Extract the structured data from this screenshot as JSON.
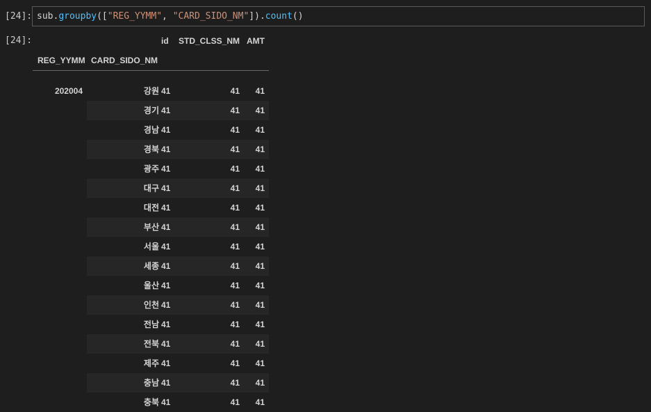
{
  "input_cell": {
    "prompt": "[24]:",
    "code": {
      "var": "sub",
      "dot1": ".",
      "fn": "groupby",
      "open": "([",
      "str1": "\"REG_YYMM\"",
      "comma": ", ",
      "str2": "\"CARD_SIDO_NM\"",
      "close": "])",
      "dot2": ".",
      "fn2": "count",
      "parens": "()"
    }
  },
  "output_cell": {
    "prompt": "[24]:",
    "table": {
      "columns": [
        "id",
        "STD_CLSS_NM",
        "AMT"
      ],
      "index_names": [
        "REG_YYMM",
        "CARD_SIDO_NM"
      ],
      "reg_yymm": "202004",
      "rows": [
        {
          "sido": "강원",
          "id": "41",
          "std": "41",
          "amt": "41"
        },
        {
          "sido": "경기",
          "id": "41",
          "std": "41",
          "amt": "41"
        },
        {
          "sido": "경남",
          "id": "41",
          "std": "41",
          "amt": "41"
        },
        {
          "sido": "경북",
          "id": "41",
          "std": "41",
          "amt": "41"
        },
        {
          "sido": "광주",
          "id": "41",
          "std": "41",
          "amt": "41"
        },
        {
          "sido": "대구",
          "id": "41",
          "std": "41",
          "amt": "41"
        },
        {
          "sido": "대전",
          "id": "41",
          "std": "41",
          "amt": "41"
        },
        {
          "sido": "부산",
          "id": "41",
          "std": "41",
          "amt": "41"
        },
        {
          "sido": "서울",
          "id": "41",
          "std": "41",
          "amt": "41"
        },
        {
          "sido": "세종",
          "id": "41",
          "std": "41",
          "amt": "41"
        },
        {
          "sido": "울산",
          "id": "41",
          "std": "41",
          "amt": "41"
        },
        {
          "sido": "인천",
          "id": "41",
          "std": "41",
          "amt": "41"
        },
        {
          "sido": "전남",
          "id": "41",
          "std": "41",
          "amt": "41"
        },
        {
          "sido": "전북",
          "id": "41",
          "std": "41",
          "amt": "41"
        },
        {
          "sido": "제주",
          "id": "41",
          "std": "41",
          "amt": "41"
        },
        {
          "sido": "충남",
          "id": "41",
          "std": "41",
          "amt": "41"
        },
        {
          "sido": "충북",
          "id": "41",
          "std": "41",
          "amt": "41"
        }
      ]
    }
  },
  "colors": {
    "background": "#1e1e1e",
    "cell_border": "#5a5a5a",
    "row_band": "#262626",
    "string": "#ce9178",
    "function": "#4fc1ff"
  }
}
